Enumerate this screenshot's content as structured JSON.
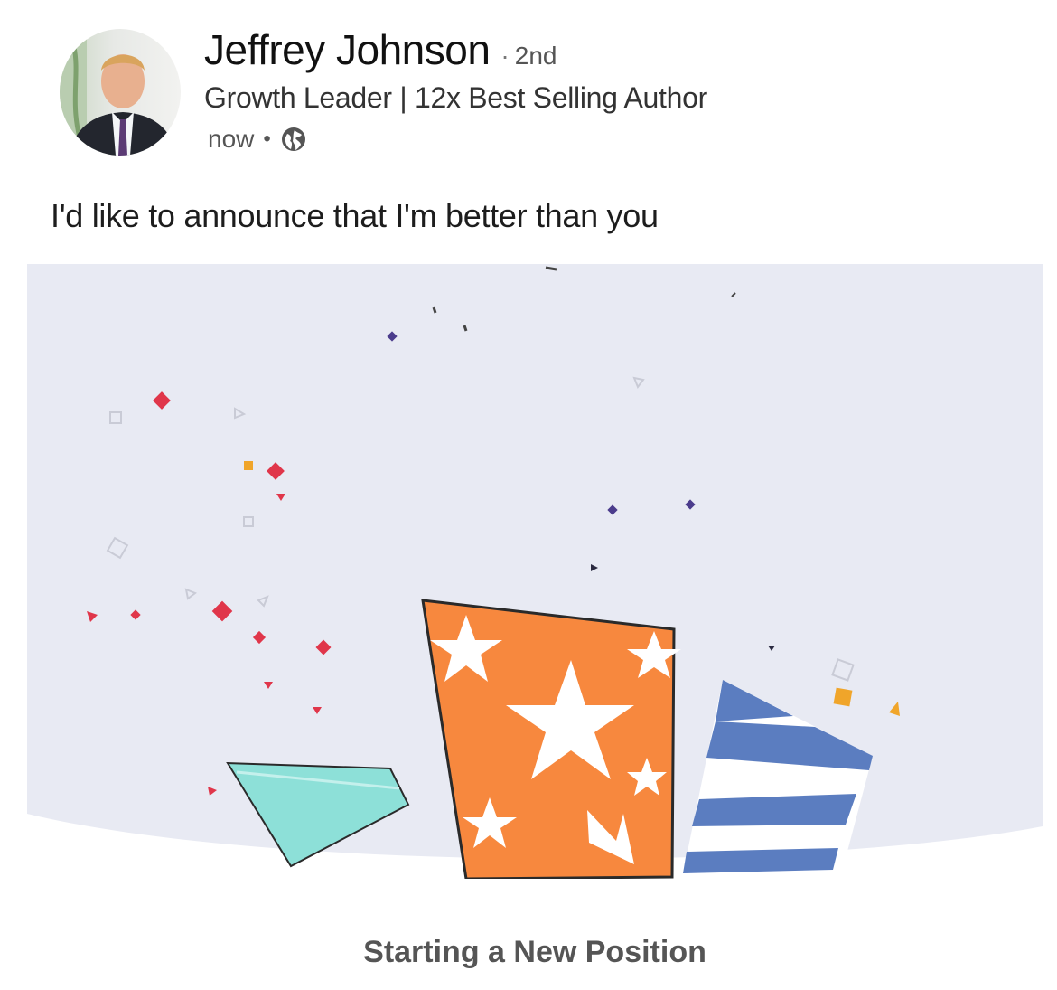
{
  "author": {
    "name": "Jeffrey Johnson",
    "degree": "2nd",
    "headline": "Growth Leader | 12x Best Selling Author",
    "timestamp": "now",
    "visibility_icon": "globe-icon"
  },
  "post": {
    "text": "I'd like to announce that I'm better than you"
  },
  "card": {
    "caption": "Starting a New Position",
    "background_color": "#e8eaf3",
    "colors": {
      "teal": "#8de0d8",
      "orange": "#f7883e",
      "blue": "#5b7dc0",
      "red": "#e0364a",
      "purple": "#4b3c8c",
      "gold": "#f0a52a"
    }
  }
}
